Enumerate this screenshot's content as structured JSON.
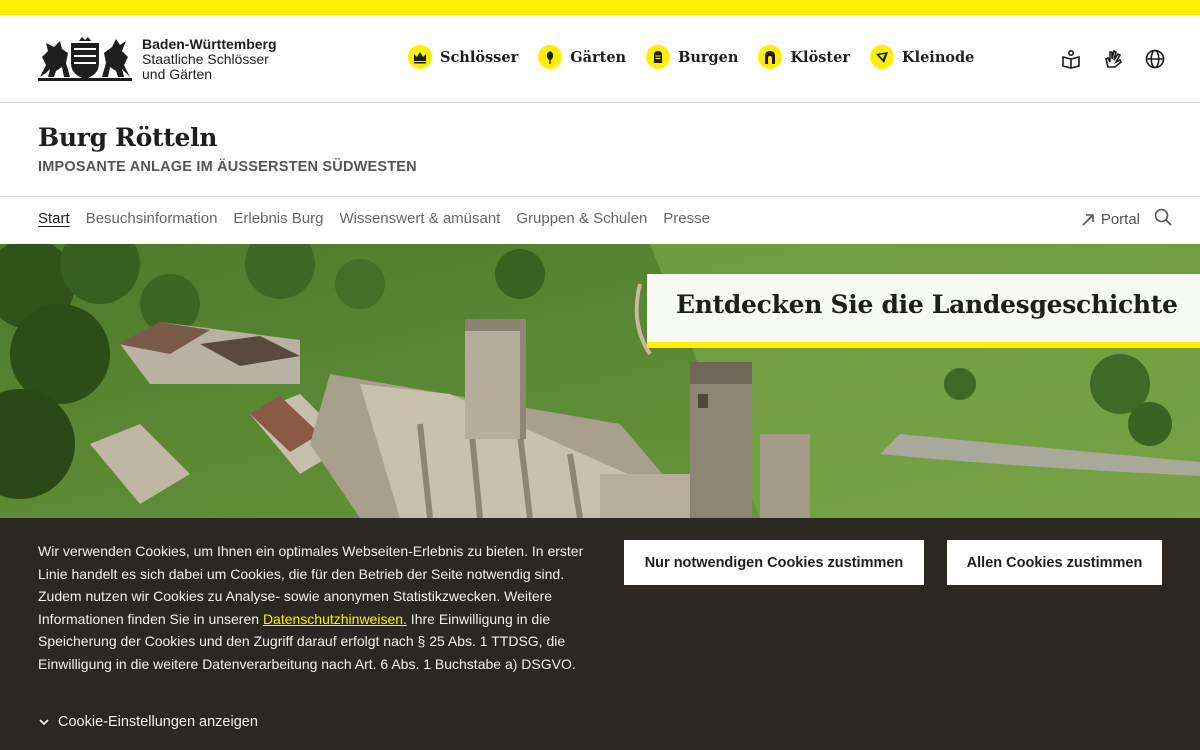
{
  "brand": {
    "line1": "Baden-Württemberg",
    "line2": "Staatliche Schlösser",
    "line3": "und Gärten",
    "accent": "#ffef00"
  },
  "mainnav": [
    {
      "label": "Schlösser",
      "icon": "crown-icon"
    },
    {
      "label": "Gärten",
      "icon": "flower-icon"
    },
    {
      "label": "Burgen",
      "icon": "knight-helmet-icon"
    },
    {
      "label": "Klöster",
      "icon": "church-window-icon"
    },
    {
      "label": "Kleinode",
      "icon": "jewel-icon"
    }
  ],
  "utilities": [
    {
      "icon": "easy-language-icon"
    },
    {
      "icon": "sign-language-icon"
    },
    {
      "icon": "globe-icon"
    }
  ],
  "page": {
    "title": "Burg Rötteln",
    "subtitle": "IMPOSANTE ANLAGE IM ÄUSSERSTEN SÜDWESTEN"
  },
  "subnav": {
    "items": [
      "Start",
      "Besuchsinformation",
      "Erlebnis Burg",
      "Wissenswert & amüsant",
      "Gruppen & Schulen",
      "Presse"
    ],
    "portal_label": "Portal"
  },
  "hero": {
    "heading": "Entdecken Sie die Landesgeschichte"
  },
  "cookie": {
    "text_before": "Wir verwenden Cookies, um Ihnen ein optimales Webseiten-Erlebnis zu bieten. In erster Linie handelt es sich dabei um Cookies, die für den Betrieb der Seite notwendig sind. Zudem nutzen wir Cookies zu Analyse- sowie anonymen Statistikzwecken. Weitere Informationen finden Sie in unseren ",
    "link_text": "Datenschutzhinweisen.",
    "text_after": " Ihre Einwilligung in die Speicherung der Cookies und den Zugriff darauf erfolgt nach § 25 Abs. 1 TTDSG, die Einwilligung in die weitere Datenverarbeitung nach Art. 6 Abs. 1 Buchstabe a) DSGVO.",
    "btn_necessary": "Nur notwendigen Cookies zustimmen",
    "btn_all": "Allen Cookies zustimmen",
    "settings_label": "Cookie-Einstellungen anzeigen"
  }
}
